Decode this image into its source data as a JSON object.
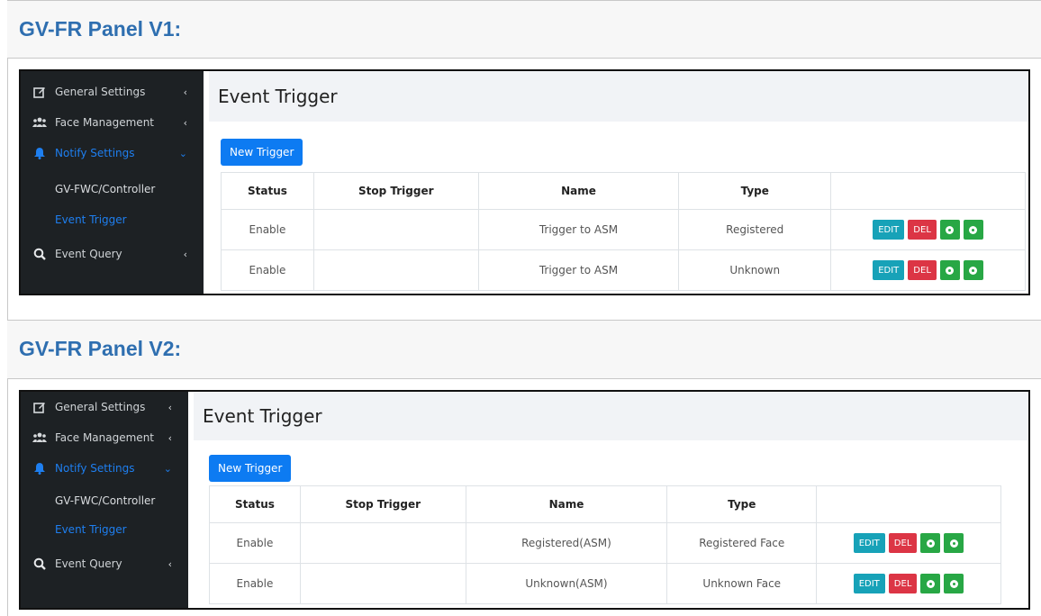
{
  "sections": [
    {
      "title": "GV-FR Panel V1:",
      "sidebar": {
        "items": [
          {
            "label": "General Settings",
            "icon": "edit-icon"
          },
          {
            "label": "Face Management",
            "icon": "users-icon"
          },
          {
            "label": "Notify Settings",
            "icon": "bell-icon"
          },
          {
            "label": "Event Query",
            "icon": "search-icon"
          }
        ],
        "sub_items": [
          {
            "label": "GV-FWC/Controller"
          },
          {
            "label": "Event Trigger"
          }
        ]
      },
      "page_title": "Event Trigger",
      "new_button": "New Trigger",
      "columns": [
        "Status",
        "Stop Trigger",
        "Name",
        "Type"
      ],
      "rows": [
        {
          "status": "Enable",
          "stop": "",
          "name": "Trigger to ASM",
          "type": "Registered"
        },
        {
          "status": "Enable",
          "stop": "",
          "name": "Trigger to ASM",
          "type": "Unknown"
        }
      ],
      "actions": {
        "edit": "EDIT",
        "del": "DEL"
      }
    },
    {
      "title": "GV-FR Panel V2:",
      "sidebar": {
        "items": [
          {
            "label": "General Settings",
            "icon": "edit-icon"
          },
          {
            "label": "Face Management",
            "icon": "users-icon"
          },
          {
            "label": "Notify Settings",
            "icon": "bell-icon"
          },
          {
            "label": "Event Query",
            "icon": "search-icon"
          }
        ],
        "sub_items": [
          {
            "label": "GV-FWC/Controller"
          },
          {
            "label": "Event Trigger"
          }
        ]
      },
      "page_title": "Event Trigger",
      "new_button": "New Trigger",
      "columns": [
        "Status",
        "Stop Trigger",
        "Name",
        "Type"
      ],
      "rows": [
        {
          "status": "Enable",
          "stop": "",
          "name": "Registered(ASM)",
          "type": "Registered Face"
        },
        {
          "status": "Enable",
          "stop": "",
          "name": "Unknown(ASM)",
          "type": "Unknown Face"
        }
      ],
      "actions": {
        "edit": "EDIT",
        "del": "DEL"
      }
    }
  ],
  "colors": {
    "heading": "#2f6fb0",
    "sidebar_bg": "#1d2124",
    "active": "#1e7ff0",
    "primary_button": "#0d7bf2",
    "edit": "#17a2b8",
    "del": "#dc3545",
    "round_button": "#28a745"
  }
}
